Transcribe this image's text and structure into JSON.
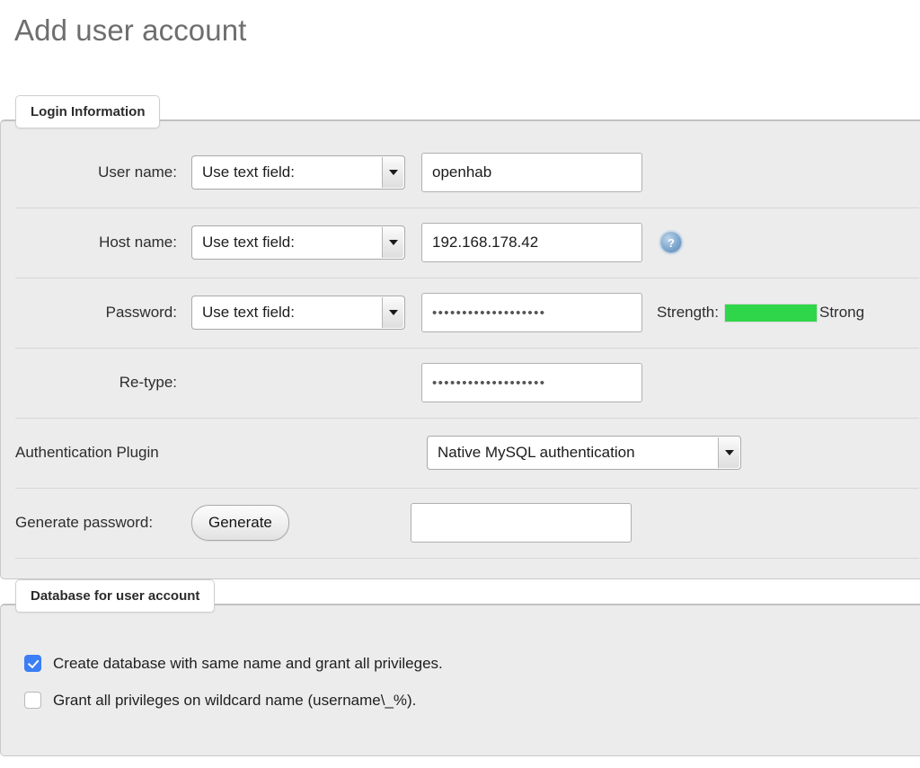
{
  "page": {
    "title": "Add user account"
  },
  "login_section": {
    "legend": "Login Information",
    "rows": {
      "user_name": {
        "label": "User name:",
        "select_value": "Use text field:",
        "input_value": "openhab",
        "input_placeholder": ""
      },
      "host_name": {
        "label": "Host name:",
        "select_value": "Use text field:",
        "input_value": "192.168.178.42",
        "input_placeholder": "",
        "help_icon": "help-question-icon",
        "help_glyph": "?"
      },
      "password": {
        "label": "Password:",
        "select_value": "Use text field:",
        "input_value": "•••••••••••••••••••",
        "input_placeholder": "",
        "strength_label": "Strength:",
        "strength_text": "Strong",
        "strength_color": "#30d649"
      },
      "retype": {
        "label": "Re-type:",
        "input_value": "•••••••••••••••••••",
        "input_placeholder": ""
      },
      "auth_plugin": {
        "label": "Authentication Plugin",
        "select_value": "Native MySQL authentication"
      },
      "generate_password": {
        "label": "Generate password:",
        "button_label": "Generate",
        "input_value": "",
        "input_placeholder": ""
      }
    }
  },
  "database_section": {
    "legend": "Database for user account",
    "checkboxes": [
      {
        "label": "Create database with same name and grant all privileges.",
        "checked": true
      },
      {
        "label": "Grant all privileges on wildcard name (username\\_%).",
        "checked": false
      }
    ]
  },
  "colors": {
    "panel_background": "#ececec",
    "page_background": "#ffffff",
    "heading": "#6e6e6e",
    "checkbox_accent": "#3b7ef5",
    "strength_strong": "#30d649",
    "border": "#c9c9c9"
  }
}
